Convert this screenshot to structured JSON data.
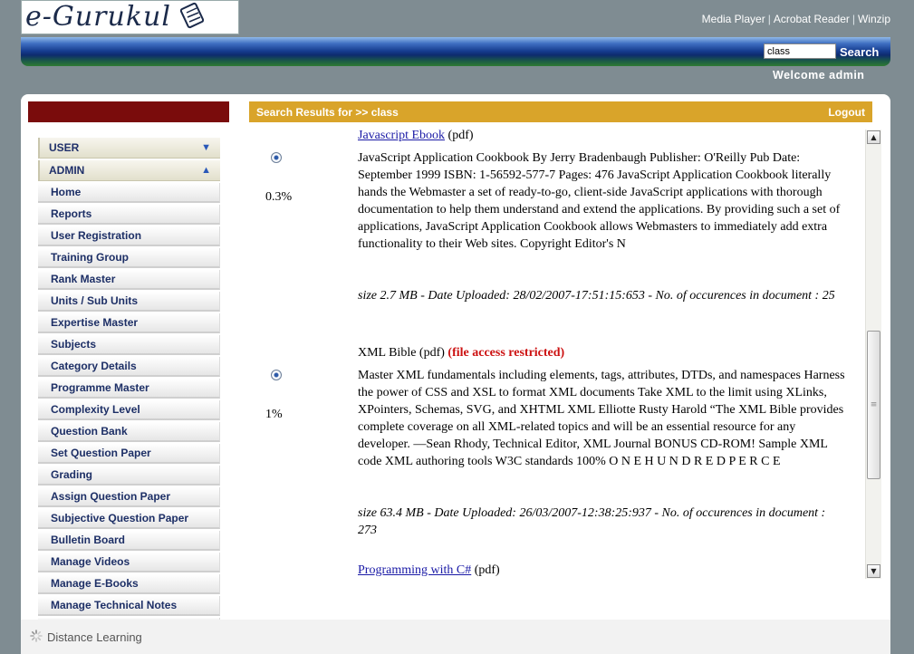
{
  "header": {
    "logo_text": "e-Gurukul",
    "links": [
      "Media Player",
      "Acrobat Reader",
      "Winzip"
    ],
    "search_value": "class",
    "search_button": "Search",
    "welcome": "Welcome  admin"
  },
  "sidebar": {
    "sections": [
      {
        "label": "USER",
        "arrow": "▼"
      },
      {
        "label": "ADMIN",
        "arrow": "▲"
      }
    ],
    "items": [
      "Home",
      "Reports",
      "User Registration",
      "Training Group",
      "Rank Master",
      "Units / Sub Units",
      "Expertise Master",
      "Subjects",
      "Category Details",
      "Programme Master",
      "Complexity Level",
      "Question Bank",
      "Set Question Paper",
      "Grading",
      "Assign Question Paper",
      "Subjective Question Paper",
      "Bulletin Board",
      "Manage Videos",
      "Manage E-Books",
      "Manage Technical Notes"
    ]
  },
  "results_header": {
    "title": "Search Results for >> class",
    "logout": "Logout"
  },
  "results": [
    {
      "title": "Javascript Ebook",
      "type": "(pdf)",
      "relevance": "0.3%",
      "description": "JavaScript Application Cookbook By Jerry Bradenbaugh Publisher: O'Reilly Pub Date: September 1999 ISBN: 1-56592-577-7 Pages: 476 JavaScript Application Cookbook literally hands the Webmaster a set of ready-to-go, client-side JavaScript applications with thorough documentation to help them understand and extend the applications. By providing such a set of applications, JavaScript Application Cookbook allows Webmasters to immediately add extra functionality to their Web sites. Copyright Editor's N",
      "meta": "size 2.7 MB - Date Uploaded: 28/02/2007-17:51:15:653 - No. of occurences in document : 25"
    },
    {
      "title": "XML Bible",
      "type": "(pdf)",
      "restricted": "(file access restricted)",
      "relevance": "1%",
      "description": "Master XML fundamentals including elements, tags, attributes, DTDs, and namespaces Harness the power of CSS and XSL to format XML documents Take XML to the limit using XLinks, XPointers, Schemas, SVG, and XHTML XML Elliotte Rusty Harold “The XML Bible provides complete coverage on all XML-related topics and will be an essential resource for any developer. —Sean Rhody, Technical Editor, XML Journal BONUS CD-ROM! Sample XML code XML authoring tools W3C standards 100% O N E H U N D R E D P E R C E",
      "meta": "size 63.4 MB - Date Uploaded: 26/03/2007-12:38:25:937 - No. of occurences in document : 273"
    },
    {
      "title": "Programming with C#",
      "type": "(pdf)"
    }
  ],
  "footer": {
    "status": "Distance Learning"
  }
}
